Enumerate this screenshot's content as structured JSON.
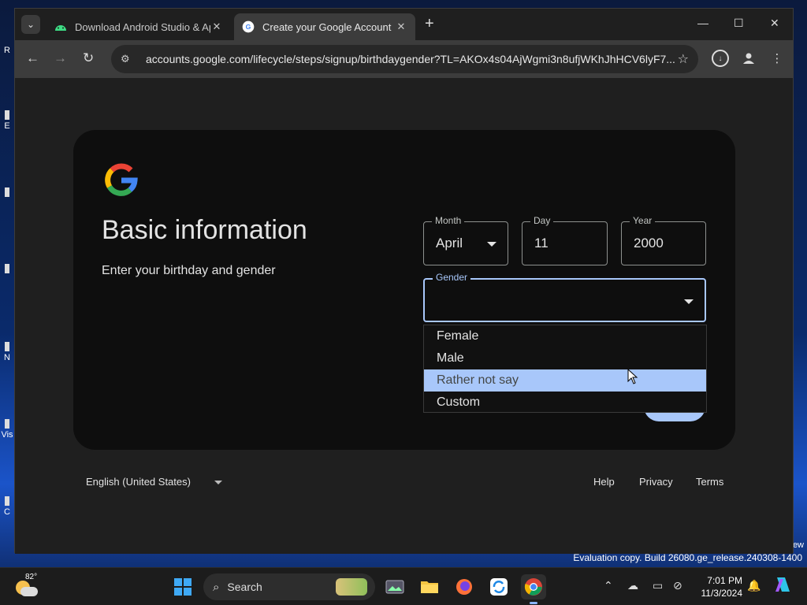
{
  "desktop": {
    "fragments": [
      "R",
      "E",
      "N",
      "Vis",
      "C"
    ],
    "right_fragment": "ew",
    "eval_notice": "Evaluation copy. Build 26080.ge_release.240308-1400"
  },
  "browser": {
    "tabs": [
      {
        "title": "Download Android Studio & Ap",
        "active": false
      },
      {
        "title": "Create your Google Account",
        "active": true
      }
    ],
    "address_bar": {
      "url": "accounts.google.com/lifecycle/steps/signup/birthdaygender?TL=AKOx4s04AjWgmi3n8ufjWKhJhHCV6lyF7..."
    }
  },
  "page": {
    "title": "Basic information",
    "subtitle": "Enter your birthday and gender",
    "month": {
      "label": "Month",
      "value": "April"
    },
    "day": {
      "label": "Day",
      "value": "11"
    },
    "year": {
      "label": "Year",
      "value": "2000"
    },
    "gender": {
      "label": "Gender",
      "value": "",
      "options": [
        "Female",
        "Male",
        "Rather not say",
        "Custom"
      ],
      "highlighted": "Rather not say"
    },
    "colors": {
      "accent": "#a8c7fa",
      "card_bg": "#0e0e0e"
    }
  },
  "footer": {
    "language": "English (United States)",
    "links": [
      "Help",
      "Privacy",
      "Terms"
    ]
  },
  "taskbar": {
    "weather_temp": "82°",
    "search_placeholder": "Search",
    "time": "7:01 PM",
    "date": "11/3/2024"
  }
}
